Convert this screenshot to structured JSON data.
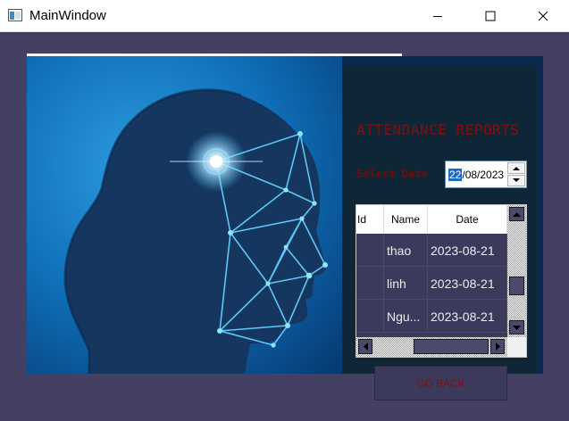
{
  "window": {
    "title": "MainWindow",
    "icons": {
      "app": "app-window-icon",
      "minimize": "minimize-icon",
      "maximize": "maximize-icon",
      "close": "close-icon"
    }
  },
  "colors": {
    "background": "#434063",
    "panel": "#0f2636",
    "accent_text": "#8b0b0b",
    "button": "#3b3a5c"
  },
  "image": {
    "icon": "face-recognition-image"
  },
  "report": {
    "title": "ATTENDANCE REPORTS",
    "select_date_label": "Select Date",
    "date": {
      "day": "22",
      "rest": "/08/2023"
    }
  },
  "table": {
    "columns": [
      "Id",
      "Name",
      "Date"
    ],
    "rows": [
      {
        "id": "",
        "name": "thao",
        "date": "2023-08-21"
      },
      {
        "id": "",
        "name": "linh",
        "date": "2023-08-21"
      },
      {
        "id": "",
        "name": "Ngu...",
        "date": "2023-08-21"
      }
    ]
  },
  "buttons": {
    "go_back": "GO BACK"
  }
}
